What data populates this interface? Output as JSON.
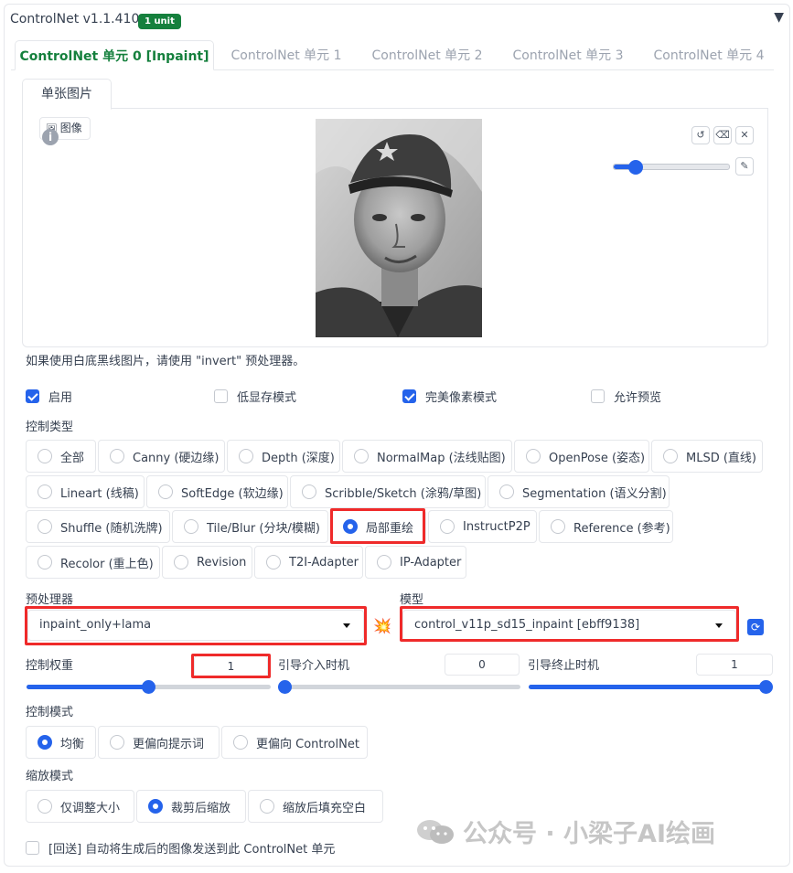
{
  "header": {
    "title": "ControlNet v1.1.410",
    "badge": "1 unit",
    "collapse_icon": "triangle-down-icon"
  },
  "tabs": [
    {
      "label": "ControlNet 单元 0 [Inpaint]",
      "active": true
    },
    {
      "label": "ControlNet 单元 1",
      "active": false
    },
    {
      "label": "ControlNet 单元 2",
      "active": false
    },
    {
      "label": "ControlNet 单元 3",
      "active": false
    },
    {
      "label": "ControlNet 单元 4",
      "active": false
    }
  ],
  "subtab": {
    "label": "单张图片"
  },
  "image_panel": {
    "label": "图像",
    "info_icon": "info-icon",
    "buttons": [
      "undo-icon",
      "eraser-icon",
      "close-icon"
    ],
    "brush_icon": "brush-icon",
    "brush_size": 0.15
  },
  "hint": "如果使用白底黑线图片，请使用 \"invert\" 预处理器。",
  "checkboxes": [
    {
      "label": "启用",
      "checked": true
    },
    {
      "label": "低显存模式",
      "checked": false
    },
    {
      "label": "完美像素模式",
      "checked": true
    },
    {
      "label": "允许预览",
      "checked": false
    }
  ],
  "control_type": {
    "label": "控制类型",
    "options": [
      {
        "label": "全部",
        "selected": false
      },
      {
        "label": "Canny (硬边缘)",
        "selected": false
      },
      {
        "label": "Depth (深度)",
        "selected": false
      },
      {
        "label": "NormalMap (法线贴图)",
        "selected": false
      },
      {
        "label": "OpenPose (姿态)",
        "selected": false
      },
      {
        "label": "MLSD (直线)",
        "selected": false
      },
      {
        "label": "Lineart (线稿)",
        "selected": false
      },
      {
        "label": "SoftEdge (软边缘)",
        "selected": false
      },
      {
        "label": "Scribble/Sketch (涂鸦/草图)",
        "selected": false
      },
      {
        "label": "Segmentation (语义分割)",
        "selected": false
      },
      {
        "label": "Shuffle (随机洗牌)",
        "selected": false
      },
      {
        "label": "Tile/Blur (分块/模糊)",
        "selected": false
      },
      {
        "label": "局部重绘",
        "selected": true
      },
      {
        "label": "InstructP2P",
        "selected": false
      },
      {
        "label": "Reference (参考)",
        "selected": false
      },
      {
        "label": "Recolor (重上色)",
        "selected": false
      },
      {
        "label": "Revision",
        "selected": false
      },
      {
        "label": "T2I-Adapter",
        "selected": false
      },
      {
        "label": "IP-Adapter",
        "selected": false
      }
    ]
  },
  "preprocessor": {
    "label": "预处理器",
    "value": "inpaint_only+lama",
    "run_icon": "explosion-icon"
  },
  "model": {
    "label": "模型",
    "value": "control_v11p_sd15_inpaint [ebff9138]",
    "refresh_icon": "refresh-icon"
  },
  "sliders": [
    {
      "label": "控制权重",
      "value": "1",
      "fraction": 0.5
    },
    {
      "label": "引导介入时机",
      "value": "0",
      "fraction": 0.0
    },
    {
      "label": "引导终止时机",
      "value": "1",
      "fraction": 1.0
    }
  ],
  "control_mode": {
    "label": "控制模式",
    "options": [
      {
        "label": "均衡",
        "selected": true
      },
      {
        "label": "更偏向提示词",
        "selected": false
      },
      {
        "label": "更偏向 ControlNet",
        "selected": false
      }
    ]
  },
  "resize_mode": {
    "label": "缩放模式",
    "options": [
      {
        "label": "仅调整大小",
        "selected": false
      },
      {
        "label": "裁剪后缩放",
        "selected": true
      },
      {
        "label": "缩放后填充空白",
        "selected": false
      }
    ]
  },
  "loopback": {
    "label": "[回送] 自动将生成后的图像发送到此 ControlNet 单元",
    "checked": false
  },
  "watermark": {
    "text": "公众号 · 小梁子AI绘画",
    "icon": "wechat-icon"
  },
  "colors": {
    "accent": "#2563eb",
    "badge": "#15803d",
    "highlight": "#ef2a2a"
  }
}
